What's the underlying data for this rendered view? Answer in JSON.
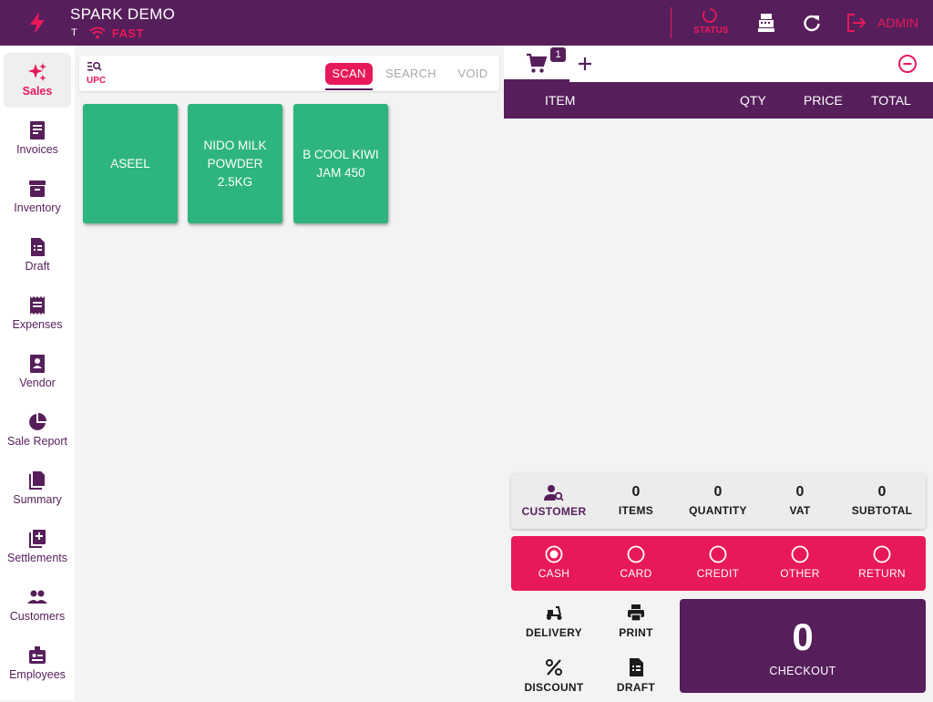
{
  "header": {
    "title": "SPARK DEMO",
    "sub": "T",
    "connection": "FAST",
    "status_label": "STATUS",
    "user": "ADMIN"
  },
  "sidebar": {
    "items": [
      {
        "label": "Sales",
        "icon": "sparkle-icon"
      },
      {
        "label": "Invoices",
        "icon": "invoice-icon"
      },
      {
        "label": "Inventory",
        "icon": "archive-icon"
      },
      {
        "label": "Draft",
        "icon": "draft-icon"
      },
      {
        "label": "Expenses",
        "icon": "receipt-icon"
      },
      {
        "label": "Vendor",
        "icon": "vendor-icon"
      },
      {
        "label": "Sale Report",
        "icon": "pie-chart-icon"
      },
      {
        "label": "Summary",
        "icon": "summary-icon"
      },
      {
        "label": "Settlements",
        "icon": "settlements-icon"
      },
      {
        "label": "Customers",
        "icon": "customers-icon"
      },
      {
        "label": "Employees",
        "icon": "employees-icon"
      }
    ]
  },
  "search": {
    "upc_label": "UPC",
    "tabs": [
      "SCAN",
      "SEARCH",
      "VOID"
    ]
  },
  "products": [
    {
      "name": "ASEEL"
    },
    {
      "name": "NIDO MILK POWDER 2.5KG"
    },
    {
      "name": "B COOL KIWI JAM 450"
    }
  ],
  "cart": {
    "badge": "1",
    "columns": [
      "ITEM",
      "QTY",
      "PRICE",
      "TOTAL"
    ]
  },
  "summary": {
    "customer_label": "CUSTOMER",
    "items": {
      "value": "0",
      "label": "ITEMS"
    },
    "quantity": {
      "value": "0",
      "label": "QUANTITY"
    },
    "vat": {
      "value": "0",
      "label": "VAT"
    },
    "subtotal": {
      "value": "0",
      "label": "SUBTOTAL"
    }
  },
  "payment": [
    "CASH",
    "CARD",
    "CREDIT",
    "OTHER",
    "RETURN"
  ],
  "payment_selected": "CASH",
  "actions": {
    "delivery": "DELIVERY",
    "print": "PRINT",
    "discount": "DISCOUNT",
    "draft": "DRAFT"
  },
  "checkout": {
    "amount": "0",
    "label": "CHECKOUT"
  },
  "colors": {
    "primary": "#561f5b",
    "accent": "#e8195a",
    "tile": "#2db57d"
  }
}
